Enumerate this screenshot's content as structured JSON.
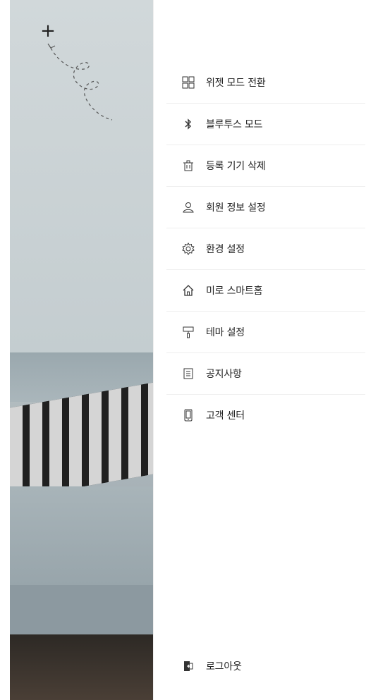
{
  "menu": {
    "items": [
      {
        "label": "위젯 모드 전환",
        "icon": "grid-icon"
      },
      {
        "label": "블루투스 모드",
        "icon": "bluetooth-icon"
      },
      {
        "label": "등록 기기 삭제",
        "icon": "trash-icon"
      },
      {
        "label": "회원 정보 설정",
        "icon": "user-icon"
      },
      {
        "label": "환경 설정",
        "icon": "gear-icon"
      },
      {
        "label": "미로 스마트홈",
        "icon": "home-icon"
      },
      {
        "label": "테마 설정",
        "icon": "paint-roller-icon"
      },
      {
        "label": "공지사항",
        "icon": "document-icon"
      },
      {
        "label": "고객 센터",
        "icon": "phone-icon"
      }
    ]
  },
  "footer": {
    "logout_label": "로그아웃",
    "logout_icon": "logout-icon"
  },
  "background": {
    "add_button_label": "+",
    "plus_icon": "plus-icon"
  }
}
